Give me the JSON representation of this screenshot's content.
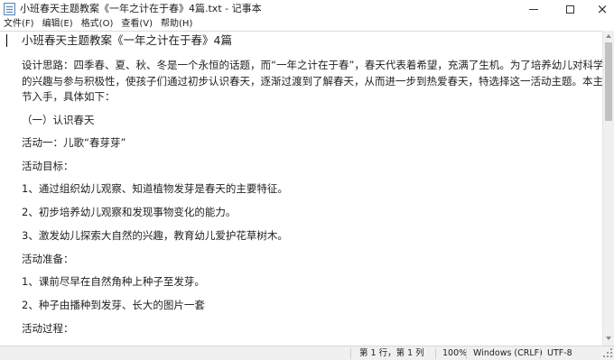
{
  "window": {
    "title": "小班春天主题教案《一年之计在于春》4篇.txt - 记事本",
    "icon": "notepad-icon"
  },
  "menu": {
    "items": [
      "文件(F)",
      "编辑(E)",
      "格式(O)",
      "查看(V)",
      "帮助(H)"
    ]
  },
  "document": {
    "lines": [
      "小班春天主题教案《一年之计在于春》4篇",
      "设计思路：四季春、夏、秋、冬是一个永恒的话题，而“一年之计在于春”，春天代表着希望，充满了生机。为了培养幼儿对科学活动",
      "的兴趣与参与积极性，使孩子们通过初步认识春天，逐渐过渡到了解春天，从而进一步到热爱春天，特选择这一活动主题。本主题从三个环",
      "节入手，具体如下：",
      "（一）认识春天",
      "活动一：儿歌“春芽芽”",
      "活动目标：",
      "1、通过组织幼儿观察、知道植物发芽是春天的主要特征。",
      "2、初步培养幼儿观察和发现事物变化的能力。",
      "3、激发幼儿探索大自然的兴趣，教育幼儿爱护花草树木。",
      "活动准备：",
      "1、课前尽早在自然角种上种子至发芽。",
      "2、种子由播种到发芽、长大的图片一套",
      "活动过程："
    ]
  },
  "status": {
    "position": "第 1 行，第 1 列",
    "zoom": "100%",
    "line_ending": "Windows (CRLF)",
    "encoding": "UTF-8"
  }
}
